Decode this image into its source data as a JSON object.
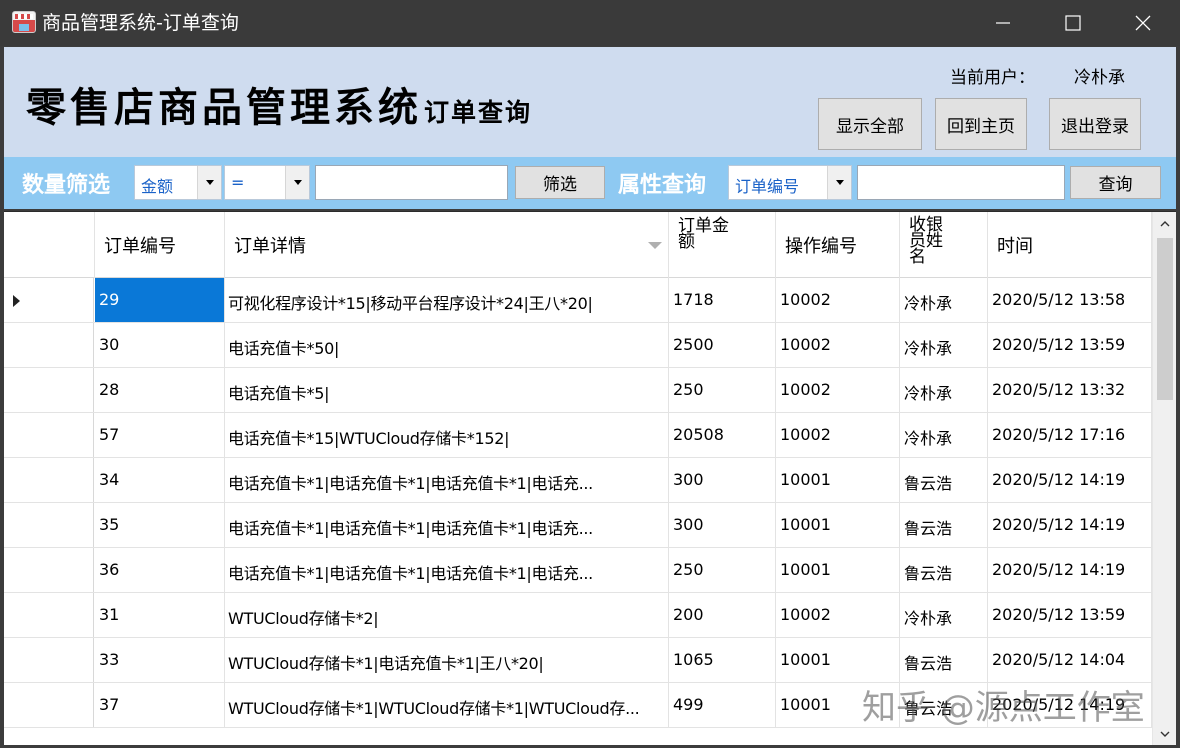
{
  "window": {
    "title": "商品管理系统-订单查询",
    "icons": {
      "app": "app-icon",
      "minimize": "minimize-icon",
      "maximize": "maximize-icon",
      "close": "close-icon"
    }
  },
  "header": {
    "banner_main": "零售店商品管理系统",
    "banner_sub": "订单查询",
    "current_user_label": "当前用户：",
    "current_user": "冷朴承",
    "buttons": {
      "show_all": "显示全部",
      "home": "回到主页",
      "logout": "退出登录"
    }
  },
  "filter": {
    "quantity_label": "数量筛选",
    "field_value": "金额",
    "operator_value": "=",
    "value_input": "",
    "filter_button": "筛选",
    "attr_label": "属性查询",
    "attr_field_value": "订单编号",
    "attr_input": "",
    "query_button": "查询"
  },
  "grid": {
    "columns": [
      "订单编号",
      "订单详情",
      "订单金额",
      "操作编号",
      "收银员姓名",
      "时间"
    ],
    "column_stacked": {
      "amount": [
        "订单金",
        "额"
      ],
      "cashier": [
        "收银",
        "员姓",
        "名"
      ]
    },
    "selected_row": 0,
    "rows": [
      [
        "29",
        "可视化程序设计*15|移动平台程序设计*24|王八*20|",
        "1718",
        "10002",
        "冷朴承",
        "2020/5/12 13:58"
      ],
      [
        "30",
        "电话充值卡*50|",
        "2500",
        "10002",
        "冷朴承",
        "2020/5/12 13:59"
      ],
      [
        "28",
        "电话充值卡*5|",
        "250",
        "10002",
        "冷朴承",
        "2020/5/12 13:32"
      ],
      [
        "57",
        "电话充值卡*15|WTUCloud存储卡*152|",
        "20508",
        "10002",
        "冷朴承",
        "2020/5/12 17:16"
      ],
      [
        "34",
        "电话充值卡*1|电话充值卡*1|电话充值卡*1|电话充...",
        "300",
        "10001",
        "鲁云浩",
        "2020/5/12 14:19"
      ],
      [
        "35",
        "电话充值卡*1|电话充值卡*1|电话充值卡*1|电话充...",
        "300",
        "10001",
        "鲁云浩",
        "2020/5/12 14:19"
      ],
      [
        "36",
        "电话充值卡*1|电话充值卡*1|电话充值卡*1|电话充...",
        "250",
        "10001",
        "鲁云浩",
        "2020/5/12 14:19"
      ],
      [
        "31",
        "WTUCloud存储卡*2|",
        "200",
        "10002",
        "冷朴承",
        "2020/5/12 13:59"
      ],
      [
        "33",
        "WTUCloud存储卡*1|电话充值卡*1|王八*20|",
        "1065",
        "10001",
        "鲁云浩",
        "2020/5/12 14:04"
      ],
      [
        "37",
        "WTUCloud存储卡*1|WTUCloud存储卡*1|WTUCloud存...",
        "499",
        "10001",
        "鲁云浩",
        "2020/5/12 14:19"
      ]
    ]
  },
  "watermark": "知乎 @源点工作室"
}
